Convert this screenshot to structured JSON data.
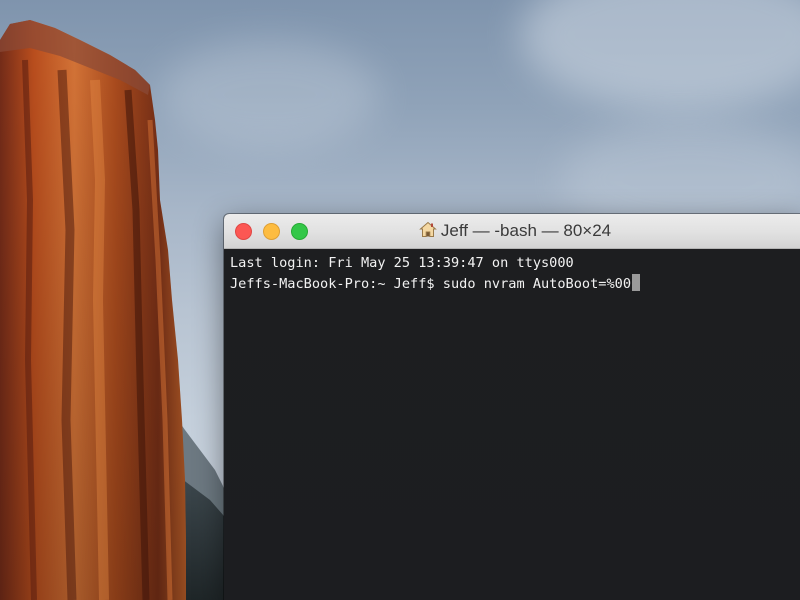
{
  "window": {
    "title": "Jeff — -bash — 80×24"
  },
  "terminal": {
    "lines": [
      "Last login: Fri May 25 13:39:47 on ttys000",
      "Jeffs-MacBook-Pro:~ Jeff$ sudo nvram AutoBoot=%00"
    ]
  },
  "colors": {
    "close": "#fc5753",
    "minimize": "#fdbc40",
    "zoom": "#33c748",
    "terminal_bg": "#1c1d1f",
    "terminal_text": "#f2f2f2"
  },
  "icons": {
    "title_icon": "home-icon",
    "cursor": "block-cursor"
  }
}
